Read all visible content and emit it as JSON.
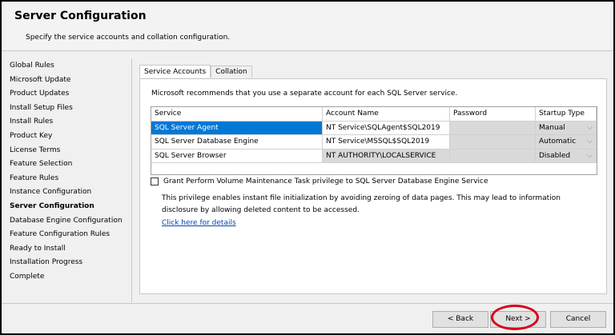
{
  "header": {
    "title": "Server Configuration",
    "subtitle": "Specify the service accounts and collation configuration."
  },
  "nav": {
    "items": [
      "Global Rules",
      "Microsoft Update",
      "Product Updates",
      "Install Setup Files",
      "Install Rules",
      "Product Key",
      "License Terms",
      "Feature Selection",
      "Feature Rules",
      "Instance Configuration",
      "Server Configuration",
      "Database Engine Configuration",
      "Feature Configuration Rules",
      "Ready to Install",
      "Installation Progress",
      "Complete"
    ],
    "active": "Server Configuration"
  },
  "tabs": [
    "Service Accounts",
    "Collation"
  ],
  "recommendation": "Microsoft recommends that you use a separate account for each SQL Server service.",
  "table": {
    "headers": [
      "Service",
      "Account Name",
      "Password",
      "Startup Type"
    ],
    "rows": [
      {
        "service": "SQL Server Agent",
        "account": "NT Service\\SQLAgent$SQL2019",
        "password": "",
        "startup": "Manual"
      },
      {
        "service": "SQL Server Database Engine",
        "account": "NT Service\\MSSQL$SQL2019",
        "password": "",
        "startup": "Automatic"
      },
      {
        "service": "SQL Server Browser",
        "account": "NT AUTHORITY\\LOCALSERVICE",
        "password": "",
        "startup": "Disabled"
      }
    ]
  },
  "grant_checkbox": {
    "label": "Grant Perform Volume Maintenance Task privilege to SQL Server Database Engine Service",
    "checked": false
  },
  "info": "This privilege enables instant file initialization by avoiding zeroing of data pages. This may lead to information disclosure by allowing deleted content to be accessed.",
  "details_link": "Click here for details",
  "footer": {
    "back": "< Back",
    "next": "Next >",
    "cancel": "Cancel"
  },
  "colors": {
    "highlight": "#0078d7",
    "annotation": "#d8001c"
  }
}
